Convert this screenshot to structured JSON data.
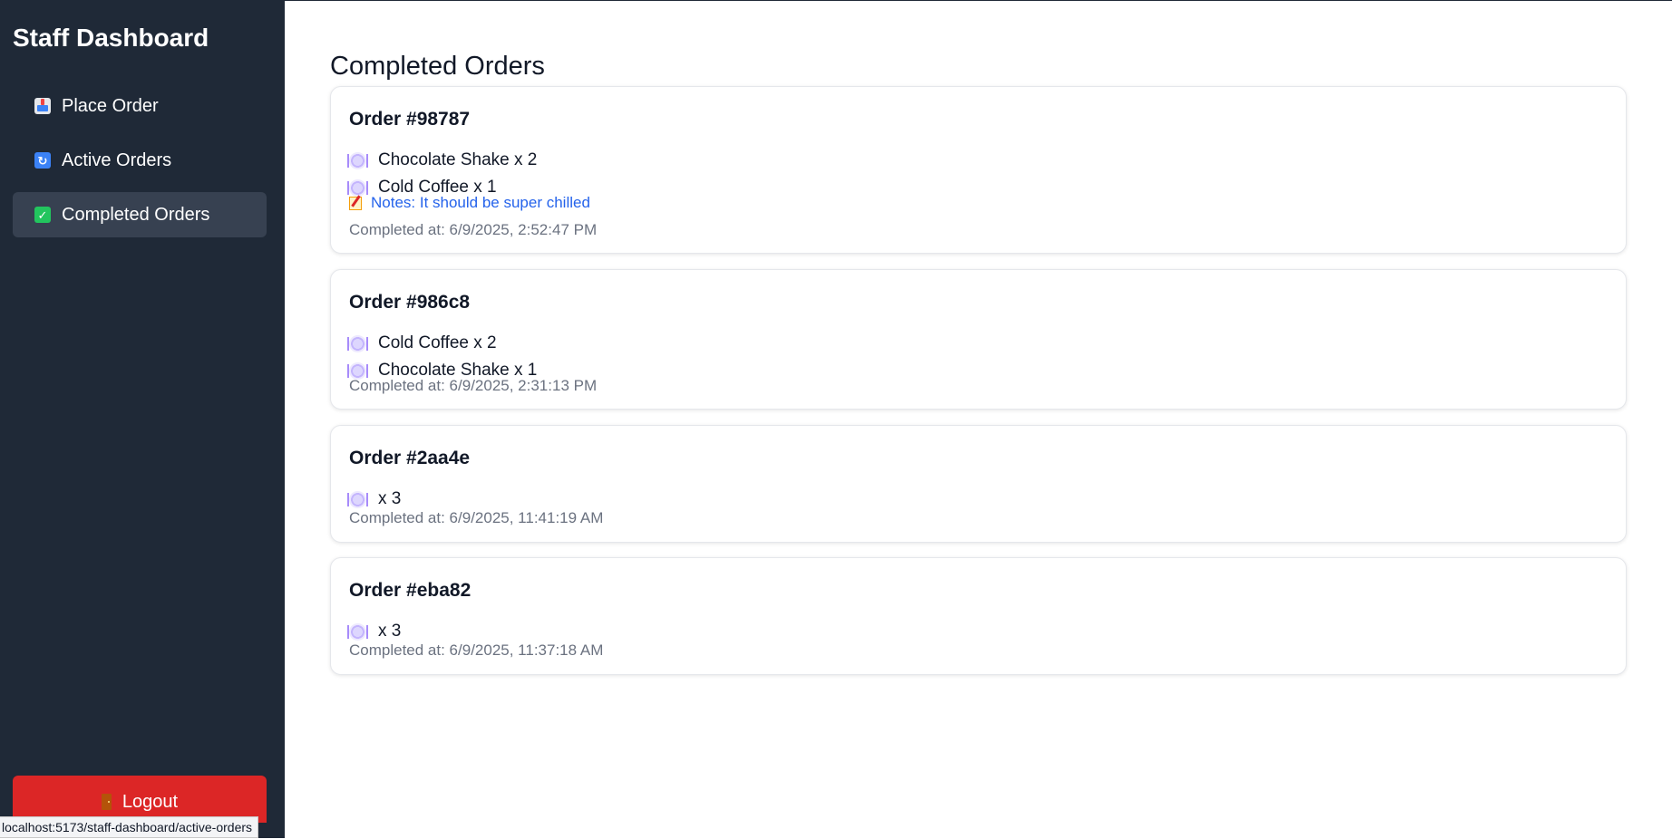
{
  "sidebar": {
    "title": "Staff Dashboard",
    "nav": [
      {
        "label": "Place Order",
        "icon": "inbox-tray-icon"
      },
      {
        "label": "Active Orders",
        "icon": "refresh-icon"
      },
      {
        "label": "Completed Orders",
        "icon": "check-mark-icon",
        "active": true
      }
    ],
    "logout_label": "Logout"
  },
  "status_bar": {
    "url": "localhost:5173/staff-dashboard/active-orders"
  },
  "main": {
    "title": "Completed Orders",
    "orders": [
      {
        "title": "Order #98787",
        "items": [
          "Chocolate Shake x 2",
          "Cold Coffee x 1"
        ],
        "notes": "Notes: It should be super chilled",
        "completed_at": "Completed at: 6/9/2025, 2:52:47 PM"
      },
      {
        "title": "Order #986c8",
        "items": [
          "Cold Coffee x 2",
          "Chocolate Shake x 1"
        ],
        "completed_at": "Completed at: 6/9/2025, 2:31:13 PM"
      },
      {
        "title": "Order #2aa4e",
        "items": [
          "x 3"
        ],
        "completed_at": "Completed at: 6/9/2025, 11:41:19 AM"
      },
      {
        "title": "Order #eba82",
        "items": [
          "x 3"
        ],
        "completed_at": "Completed at: 6/9/2025, 11:37:18 AM"
      }
    ]
  },
  "colors": {
    "sidebar_bg": "#1f2937",
    "active_nav_bg": "#374151",
    "logout_bg": "#dc2626",
    "notes_text": "#2563eb",
    "muted_text": "#6b7280"
  }
}
